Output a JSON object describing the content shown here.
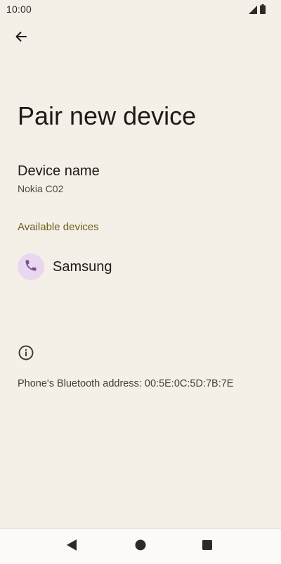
{
  "status_bar": {
    "time": "10:00",
    "icons": [
      "signal-icon",
      "battery-icon"
    ]
  },
  "toolbar": {
    "back_icon": "arrow-back-icon"
  },
  "page": {
    "title": "Pair new device"
  },
  "device_name": {
    "label": "Device name",
    "value": "Nokia C02"
  },
  "available_devices": {
    "header": "Available devices",
    "items": [
      {
        "label": "Samsung",
        "icon": "phone-icon"
      }
    ]
  },
  "info": {
    "icon": "info-icon",
    "bluetooth_address": "Phone's Bluetooth address: 00:5E:0C:5D:7B:7E"
  },
  "navigation_bar": {
    "buttons": [
      "nav-back-icon",
      "nav-home-icon",
      "nav-recents-icon"
    ]
  },
  "colors": {
    "background": "#f4f0e7",
    "accent_text": "#6a5d1b",
    "avatar_bg": "#e9d7f0",
    "avatar_icon": "#7e4a95"
  }
}
